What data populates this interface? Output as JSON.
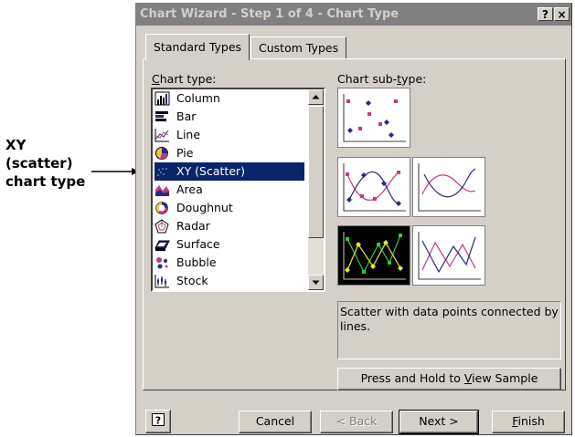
{
  "callout": {
    "line1": "XY",
    "line2": "(scatter)",
    "line3": "chart type"
  },
  "dialog": {
    "title": "Chart Wizard - Step 1 of 4 - Chart Type",
    "help_glyph": "?",
    "close_glyph": "×",
    "tabs": [
      {
        "label": "Standard Types",
        "active": true
      },
      {
        "label": "Custom Types",
        "active": false
      }
    ],
    "chart_type_label_pre": "C",
    "chart_type_label_post": "hart type:",
    "subtype_label_pre": "Chart sub-",
    "subtype_label_u": "t",
    "subtype_label_post": "ype:",
    "chart_types": [
      {
        "label": "Column",
        "icon": "column-chart-icon"
      },
      {
        "label": "Bar",
        "icon": "bar-chart-icon"
      },
      {
        "label": "Line",
        "icon": "line-chart-icon"
      },
      {
        "label": "Pie",
        "icon": "pie-chart-icon"
      },
      {
        "label": "XY (Scatter)",
        "icon": "scatter-chart-icon",
        "selected": true
      },
      {
        "label": "Area",
        "icon": "area-chart-icon"
      },
      {
        "label": "Doughnut",
        "icon": "doughnut-chart-icon"
      },
      {
        "label": "Radar",
        "icon": "radar-chart-icon"
      },
      {
        "label": "Surface",
        "icon": "surface-chart-icon"
      },
      {
        "label": "Bubble",
        "icon": "bubble-chart-icon"
      },
      {
        "label": "Stock",
        "icon": "stock-chart-icon"
      }
    ],
    "description": "Scatter with data points connected by lines.",
    "view_sample_pre": "Press and Hold to ",
    "view_sample_u": "V",
    "view_sample_post": "iew Sample",
    "buttons": {
      "cancel": "Cancel",
      "back": "< Back",
      "next": "Next >",
      "finish_u": "F",
      "finish_post": "inish"
    },
    "colors": {
      "selection": "#0a246a",
      "dialog_face": "#d4d0c8",
      "title_inactive": "#808080",
      "magenta_series": "#c0398a",
      "navy_series": "#2a2a7a",
      "green_series": "#2ecc40",
      "yellow_series": "#e8e830"
    }
  }
}
